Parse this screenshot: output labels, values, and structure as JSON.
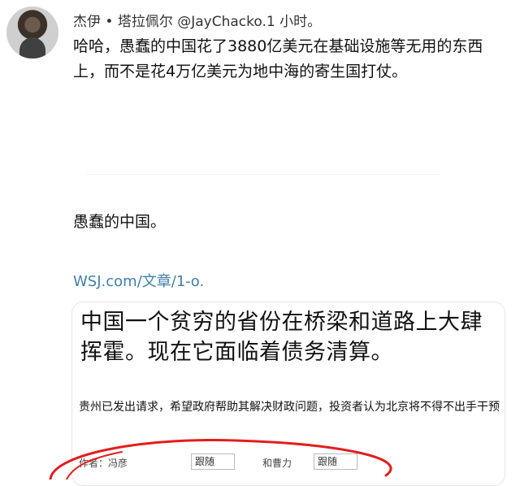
{
  "tweet": {
    "author_line": "杰伊 • 塔拉佩尔 @JayChacko.1 小时。",
    "text": "哈哈，愚蠢的中国花了3880亿美元在基础设施等无用的东西上，而不是花4万亿美元为地中海的寄生国打仗。",
    "quote": "愚蠢的中国。",
    "link": "WSJ.com/文章/1-o."
  },
  "card": {
    "title": "中国一个贫穷的省份在桥梁和道路上大肆挥霍。现在它面临着债务清算。",
    "description": "贵州已发出请求，希望政府帮助其解决财政问题，投资者认为北京将不得不出手干预",
    "author1": "作者：冯彦",
    "follow1": "跟随",
    "author2": "和曹力",
    "follow2": "跟随"
  },
  "colors": {
    "link": "#3f7fae",
    "annotation_circle": "#e31d1d"
  }
}
